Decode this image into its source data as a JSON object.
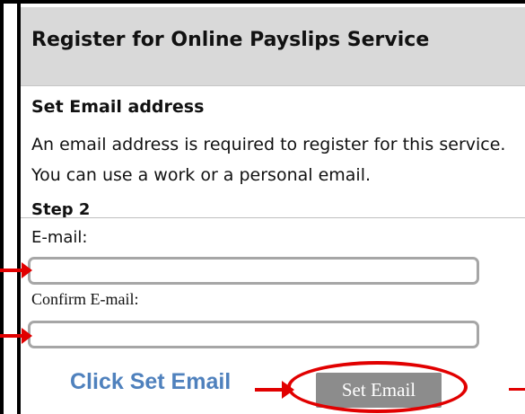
{
  "header": {
    "title": "Register for Online Payslips Service"
  },
  "section": {
    "title": "Set Email address",
    "description": "An email address is required to register for this service.  You can use a work or a personal email."
  },
  "step": {
    "label": "Step 2"
  },
  "form": {
    "email_label": "E-mail:",
    "email_value": "",
    "confirm_label": "Confirm E-mail:",
    "confirm_value": "",
    "submit_label": "Set Email"
  },
  "annotation": {
    "instruction": "Click Set Email"
  },
  "colors": {
    "accent_red": "#e10000",
    "instruction_blue": "#4f81bd",
    "button_gray": "#8c8c8c",
    "header_gray": "#d9d9d9"
  }
}
